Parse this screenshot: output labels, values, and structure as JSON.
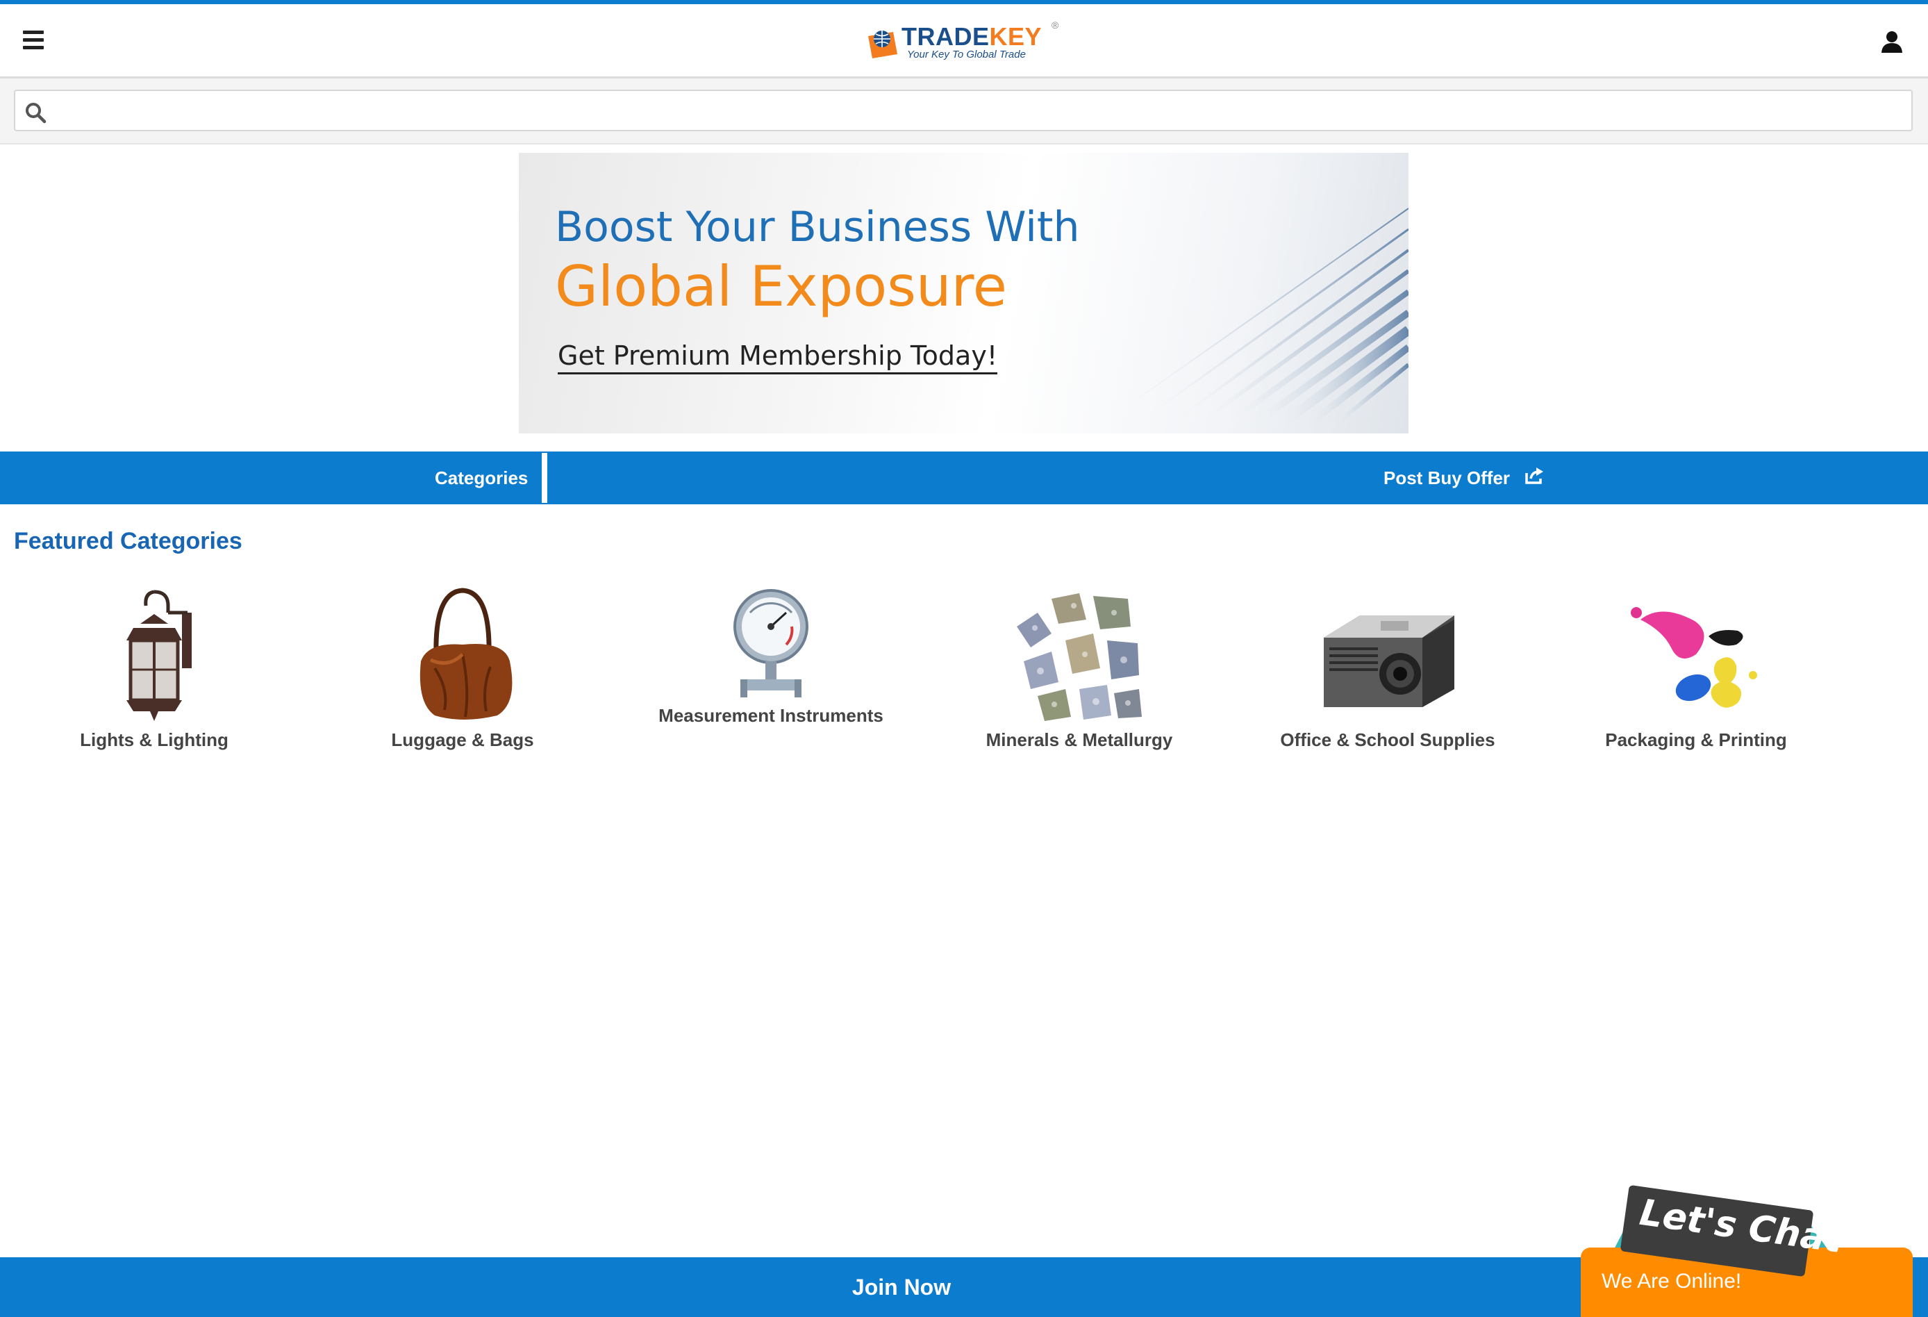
{
  "header": {
    "logo": {
      "word_part1": "TRADE",
      "word_part2": "KEY",
      "tagline": "Your Key To Global Trade",
      "registered": "®"
    },
    "menu_icon": "hamburger-icon",
    "user_icon": "user-icon"
  },
  "search": {
    "placeholder": "",
    "value": "",
    "icon": "search-icon"
  },
  "banner": {
    "line1": "Boost Your Business With",
    "line2": "Global Exposure",
    "line3": "Get Premium Membership Today!"
  },
  "nav": {
    "categories_label": "Categories",
    "categories_icon": "grid-icon",
    "post_label": "Post Buy Offer",
    "post_icon": "share-icon"
  },
  "featured": {
    "title": "Featured Categories",
    "items": [
      {
        "label": "Lights & Lighting",
        "icon": "lantern-icon"
      },
      {
        "label": "Luggage & Bags",
        "icon": "handbag-icon"
      },
      {
        "label": "Measurement Instruments",
        "icon": "gauge-icon"
      },
      {
        "label": "Minerals & Metallurgy",
        "icon": "minerals-icon"
      },
      {
        "label": "Office & School Supplies",
        "icon": "projector-icon"
      },
      {
        "label": "Packaging & Printing",
        "icon": "ink-icon"
      }
    ]
  },
  "footer": {
    "join_label": "Join Now"
  },
  "chat": {
    "tag": "Let's Chat",
    "status": "We Are Online!"
  },
  "colors": {
    "brand_blue": "#0c7ccf",
    "accent_orange": "#ff8c00",
    "title_blue": "#1765b3"
  }
}
